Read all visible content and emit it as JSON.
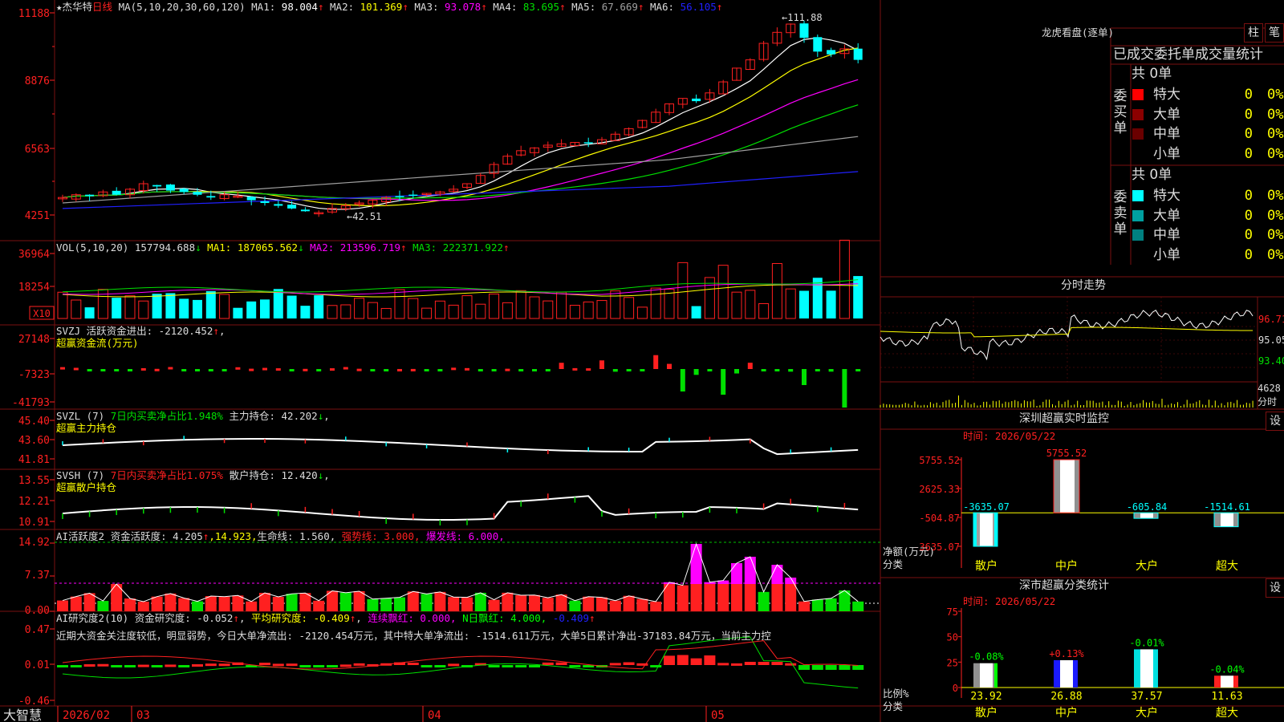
{
  "app": {
    "name": "大智慧",
    "stock": "杰华特",
    "period": "日线"
  },
  "colors": {
    "up": "#ff2020",
    "down": "#00ffff",
    "grid": "#7a1010",
    "ma1": "#ffffff",
    "ma2": "#ffff00",
    "ma3": "#ff00ff",
    "ma4": "#00e000",
    "ma5": "#a0a0a0",
    "ma6": "#2020ff"
  },
  "price_panel": {
    "legend": {
      "star": "★",
      "stock": "杰华特",
      "period": "日线",
      "ma_label": "MA(5,10,20,30,60,120)",
      "items": [
        {
          "k": "MA1:",
          "v": "98.004↑",
          "c": "ma1"
        },
        {
          "k": "MA2:",
          "v": "101.369↑",
          "c": "ma2"
        },
        {
          "k": "MA3:",
          "v": "93.078↑",
          "c": "ma3"
        },
        {
          "k": "MA4:",
          "v": "83.695↑",
          "c": "ma4"
        },
        {
          "k": "MA5:",
          "v": "67.669↑",
          "c": "ma5"
        },
        {
          "k": "MA6:",
          "v": "56.105↑",
          "c": "ma6"
        }
      ]
    },
    "yticks": [
      "11188",
      "8876",
      "6563",
      "4251"
    ],
    "max_label": "111.88",
    "min_label": "42.51"
  },
  "vol_panel": {
    "legend_prefix": "VOL(5,10,20)",
    "value": "157794.688↓",
    "items": [
      {
        "k": "MA1:",
        "v": "187065.562↓",
        "c": "ma2"
      },
      {
        "k": "MA2:",
        "v": "213596.719↑",
        "c": "ma3"
      },
      {
        "k": "MA3:",
        "v": "222371.922↑",
        "c": "ma4"
      }
    ],
    "yticks": [
      "36964",
      "18254"
    ],
    "unit": "X10"
  },
  "svzj_panel": {
    "line1": "SVZJ  活跃资金进出: -2120.452↑,",
    "line2": "超赢资金流(万元)",
    "yticks": [
      "27148",
      "-7323",
      "-41793"
    ]
  },
  "svzl_panel": {
    "prefix": "SVZL (7)",
    "green_text": "7日内买卖净占比1.948%",
    "white_text": "主力持仓: 42.202↓,",
    "line2": "超赢主力持仓",
    "yticks": [
      "45.40",
      "43.60",
      "41.81"
    ]
  },
  "svsh_panel": {
    "prefix": "SVSH (7)",
    "red_text": "7日内买卖净占比1.075%",
    "white_text": "散户持仓: 12.420↓,",
    "line2": "超赢散户持仓",
    "yticks": [
      "13.55",
      "12.21",
      "10.91"
    ]
  },
  "ai_active_panel": {
    "t1": "AI活跃度2 资金活跃度: 4.205↑",
    "t2": ",14.923,",
    "t3": "生命线: 1.560,",
    "t4": "强势线: 3.000,",
    "t5": "爆发线: 6.000,",
    "yticks": [
      "14.92",
      "7.37",
      "0.00"
    ]
  },
  "ai_research_panel": {
    "t1": "AI研究度2(10) 资金研究度: -0.052↑,",
    "t2": "平均研究度: -0.409↑,",
    "t3": "连续飘红: 0.000,",
    "t4": "N日飘红: 4.000,",
    "t5": "-0.409↑",
    "desc": "近期大资金关注度较低，明显弱势，今日大单净流出: -2120.454万元，其中特大单净流出: -1514.611万元，大单5日累计净出-37183.84万元，当前主力控",
    "yticks": [
      "0.47",
      "0.01",
      "-0.46"
    ]
  },
  "dates": [
    "2026/02",
    "03",
    "04",
    "05"
  ],
  "dragon": {
    "title": "龙虎看盘(逐单)",
    "btn1": "柱",
    "btn2": "笔",
    "tabs": "已成交委托单成交量统计",
    "buy": {
      "label": "委买单",
      "total": "共 0单",
      "rows": [
        {
          "name": "特大",
          "count": "0",
          "pct": "0%",
          "color": "#ff0000"
        },
        {
          "name": "大单",
          "count": "0",
          "pct": "0%",
          "color": "#8b0000"
        },
        {
          "name": "中单",
          "count": "0",
          "pct": "0%",
          "color": "#6a0000"
        },
        {
          "name": "小单",
          "count": "0",
          "pct": "0%",
          "color": ""
        }
      ]
    },
    "sell": {
      "label": "委卖单",
      "total": "共 0单",
      "rows": [
        {
          "name": "特大",
          "count": "0",
          "pct": "0%",
          "color": "#00ffff"
        },
        {
          "name": "大单",
          "count": "0",
          "pct": "0%",
          "color": "#00a0a0"
        },
        {
          "name": "中单",
          "count": "0",
          "pct": "0%",
          "color": "#008080"
        },
        {
          "name": "小单",
          "count": "0",
          "pct": "0%",
          "color": ""
        }
      ]
    }
  },
  "intraday": {
    "title": "分时走势",
    "price_ticks": [
      "96.71",
      "95.05",
      "93.40"
    ],
    "vol_tick": "4628",
    "vol_unit": "分时"
  },
  "sz_monitor": {
    "title": "深圳超赢实时监控",
    "btn": "设",
    "time": "时间: 2026/05/22",
    "yticks": [
      "5755.52",
      "2625.33",
      "-504.87",
      "-3635.07"
    ],
    "ylabel": "净额(万元)",
    "xlabel": "分类"
  },
  "sz_stats": {
    "title": "深市超赢分类统计",
    "btn": "设",
    "time": "时间: 2026/05/22",
    "yticks": [
      "75",
      "50",
      "25",
      "0"
    ],
    "ylabel": "比例%",
    "xlabel": "分类"
  },
  "chart_data": [
    {
      "type": "candlestick",
      "title": "杰华特 日线",
      "x": [
        "2026/02",
        "03",
        "04",
        "05"
      ],
      "ylim": [
        4251,
        11188
      ],
      "max": 111.88,
      "min": 42.51
    },
    {
      "type": "bar",
      "title": "深圳超赢实时监控",
      "categories": [
        "散户",
        "中户",
        "大户",
        "超大"
      ],
      "values": [
        -3635.07,
        5755.52,
        -605.84,
        -1514.61
      ],
      "ylabel": "净额(万元)",
      "ylim": [
        -3635.07,
        5755.52
      ]
    },
    {
      "type": "bar",
      "title": "深市超赢分类统计",
      "categories": [
        "散户",
        "中户",
        "大户",
        "超大"
      ],
      "values": [
        23.92,
        26.88,
        37.57,
        11.63
      ],
      "changes": [
        "-0.08%",
        "+0.13%",
        "-0.01%",
        "-0.04%"
      ],
      "ylabel": "比例%",
      "ylim": [
        0,
        75
      ]
    }
  ]
}
